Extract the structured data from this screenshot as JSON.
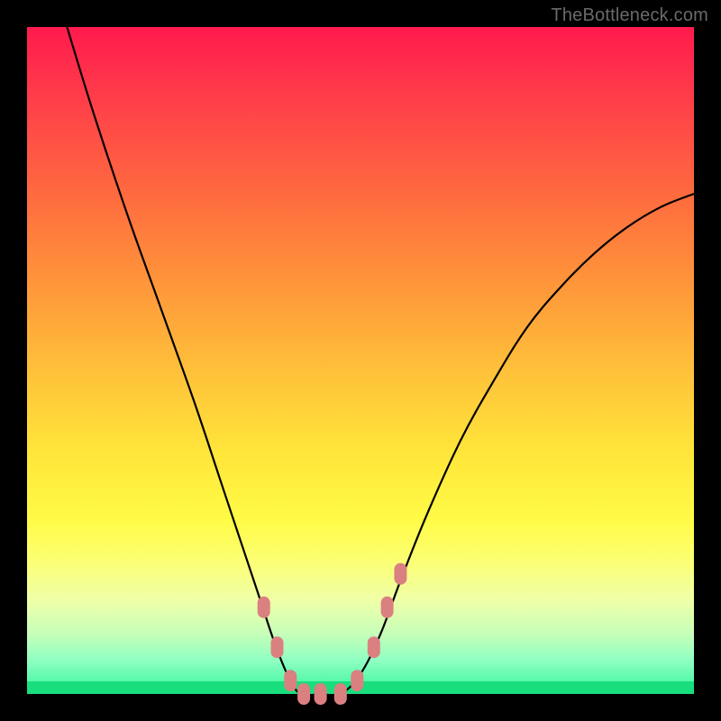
{
  "watermark": "TheBottleneck.com",
  "colors": {
    "bg": "#000000",
    "gradient_top": "#ff1a4d",
    "gradient_bottom": "#34f59a",
    "curve": "#000000",
    "marker": "#db8080"
  },
  "chart_data": {
    "type": "line",
    "title": "",
    "xlabel": "",
    "ylabel": "",
    "xlim": [
      0,
      100
    ],
    "ylim": [
      0,
      100
    ],
    "grid": false,
    "legend": false,
    "series": [
      {
        "name": "bottleneck-curve",
        "x": [
          6,
          10,
          15,
          20,
          25,
          29,
          32,
          35,
          37,
          39,
          41,
          44,
          47,
          50,
          53,
          56,
          60,
          65,
          70,
          75,
          80,
          85,
          90,
          95,
          100
        ],
        "y": [
          100,
          87,
          72,
          58,
          44,
          32,
          23,
          14,
          8,
          3,
          0,
          0,
          0,
          3,
          9,
          17,
          27,
          38,
          47,
          55,
          61,
          66,
          70,
          73,
          75
        ]
      }
    ],
    "markers": {
      "name": "highlight-points",
      "x": [
        35.5,
        37.5,
        39.5,
        41.5,
        44,
        47,
        49.5,
        52,
        54,
        56
      ],
      "y": [
        13,
        7,
        2,
        0,
        0,
        0,
        2,
        7,
        13,
        18
      ]
    }
  }
}
